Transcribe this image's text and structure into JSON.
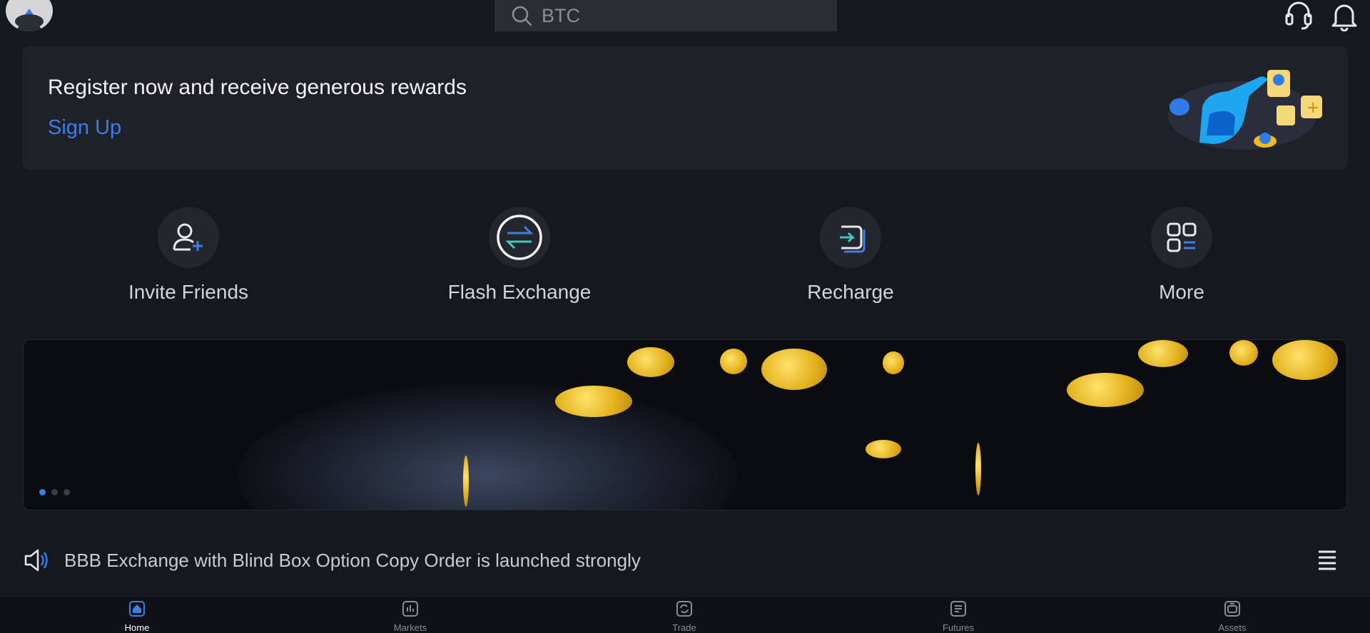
{
  "search": {
    "placeholder": "BTC"
  },
  "top_icons": [
    "customer-service-icon",
    "bell-icon"
  ],
  "banner": {
    "title": "Register now and receive generous rewards",
    "signup_label": "Sign Up"
  },
  "shortcuts": [
    {
      "label": "Invite Friends",
      "icon": "invite-user-icon"
    },
    {
      "label": "Flash Exchange",
      "icon": "exchange-arrows-icon"
    },
    {
      "label": "Recharge",
      "icon": "deposit-icon"
    },
    {
      "label": "More",
      "icon": "grid-more-icon"
    }
  ],
  "carousel": {
    "slide_count": 3,
    "active_index": 0
  },
  "notice": {
    "text": "BBB Exchange with Blind Box Option Copy Order is launched strongly"
  },
  "tabs": [
    {
      "label": "Home",
      "icon": "home-icon",
      "active": true
    },
    {
      "label": "Markets",
      "icon": "chart-bars-icon",
      "active": false
    },
    {
      "label": "Trade",
      "icon": "trade-swap-icon",
      "active": false
    },
    {
      "label": "Futures",
      "icon": "futures-doc-icon",
      "active": false
    },
    {
      "label": "Assets",
      "icon": "wallet-icon",
      "active": false
    }
  ],
  "colors": {
    "accent": "#3d7de8",
    "background": "#161820",
    "card": "#1f2128",
    "gold": "#ffd44a"
  }
}
